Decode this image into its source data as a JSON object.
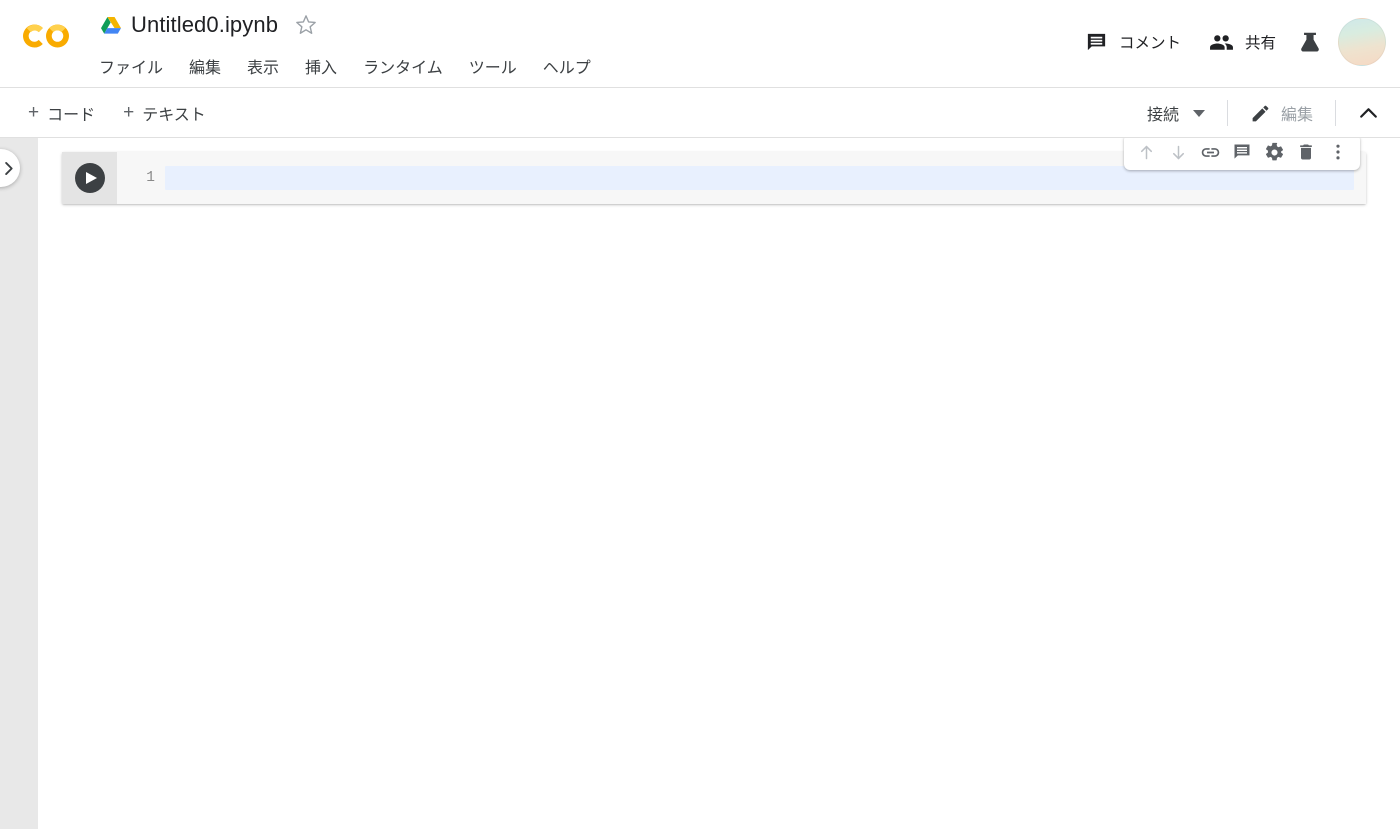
{
  "app": {
    "name": "Google Colab",
    "logo_icon": "colab-logo-icon"
  },
  "header": {
    "drive_icon": "google-drive-icon",
    "notebook_title": "Untitled0.ipynb",
    "star_icon": "star-outline-icon",
    "menu": [
      {
        "label": "ファイル",
        "name": "menu-file"
      },
      {
        "label": "編集",
        "name": "menu-edit"
      },
      {
        "label": "表示",
        "name": "menu-view"
      },
      {
        "label": "挿入",
        "name": "menu-insert"
      },
      {
        "label": "ランタイム",
        "name": "menu-runtime"
      },
      {
        "label": "ツール",
        "name": "menu-tools"
      },
      {
        "label": "ヘルプ",
        "name": "menu-help"
      }
    ],
    "comment_label": "コメント",
    "comment_icon": "comment-icon",
    "share_label": "共有",
    "share_icon": "people-icon",
    "labs_icon": "flask-icon",
    "avatar_icon": "user-avatar"
  },
  "toolbar": {
    "add_code_label": "コード",
    "add_text_label": "テキスト",
    "plus_symbol": "+",
    "connect_label": "接続",
    "connect_caret_icon": "caret-down-icon",
    "edit_label": "編集",
    "edit_icon": "pencil-icon",
    "collapse_icon": "chevron-up-icon"
  },
  "sidebar": {
    "toggle_icon": "chevron-right-icon"
  },
  "notebook": {
    "cells": [
      {
        "type": "code",
        "line_number": "1",
        "content": "",
        "run_icon": "play-icon",
        "active": true
      }
    ],
    "cell_toolbar": [
      {
        "name": "move-cell-up-button",
        "icon": "arrow-up-icon",
        "disabled": true
      },
      {
        "name": "move-cell-down-button",
        "icon": "arrow-down-icon",
        "disabled": true
      },
      {
        "name": "link-to-cell-button",
        "icon": "link-icon",
        "disabled": false
      },
      {
        "name": "add-comment-button",
        "icon": "comment-icon",
        "disabled": false
      },
      {
        "name": "cell-settings-button",
        "icon": "gear-icon",
        "disabled": false
      },
      {
        "name": "delete-cell-button",
        "icon": "trash-icon",
        "disabled": false
      },
      {
        "name": "more-cell-actions-button",
        "icon": "more-vert-icon",
        "disabled": false
      }
    ]
  },
  "colors": {
    "accent_yellow": "#F9AB00",
    "drive_blue": "#4285F4",
    "drive_green": "#0F9D58",
    "drive_yellow": "#F4B400",
    "active_line": "#E8F0FE",
    "gutter": "#E4E4E4",
    "page_bg": "#E8E8E8",
    "text_primary": "#202124",
    "text_secondary": "#5F6368",
    "text_disabled": "#9AA0A6"
  }
}
